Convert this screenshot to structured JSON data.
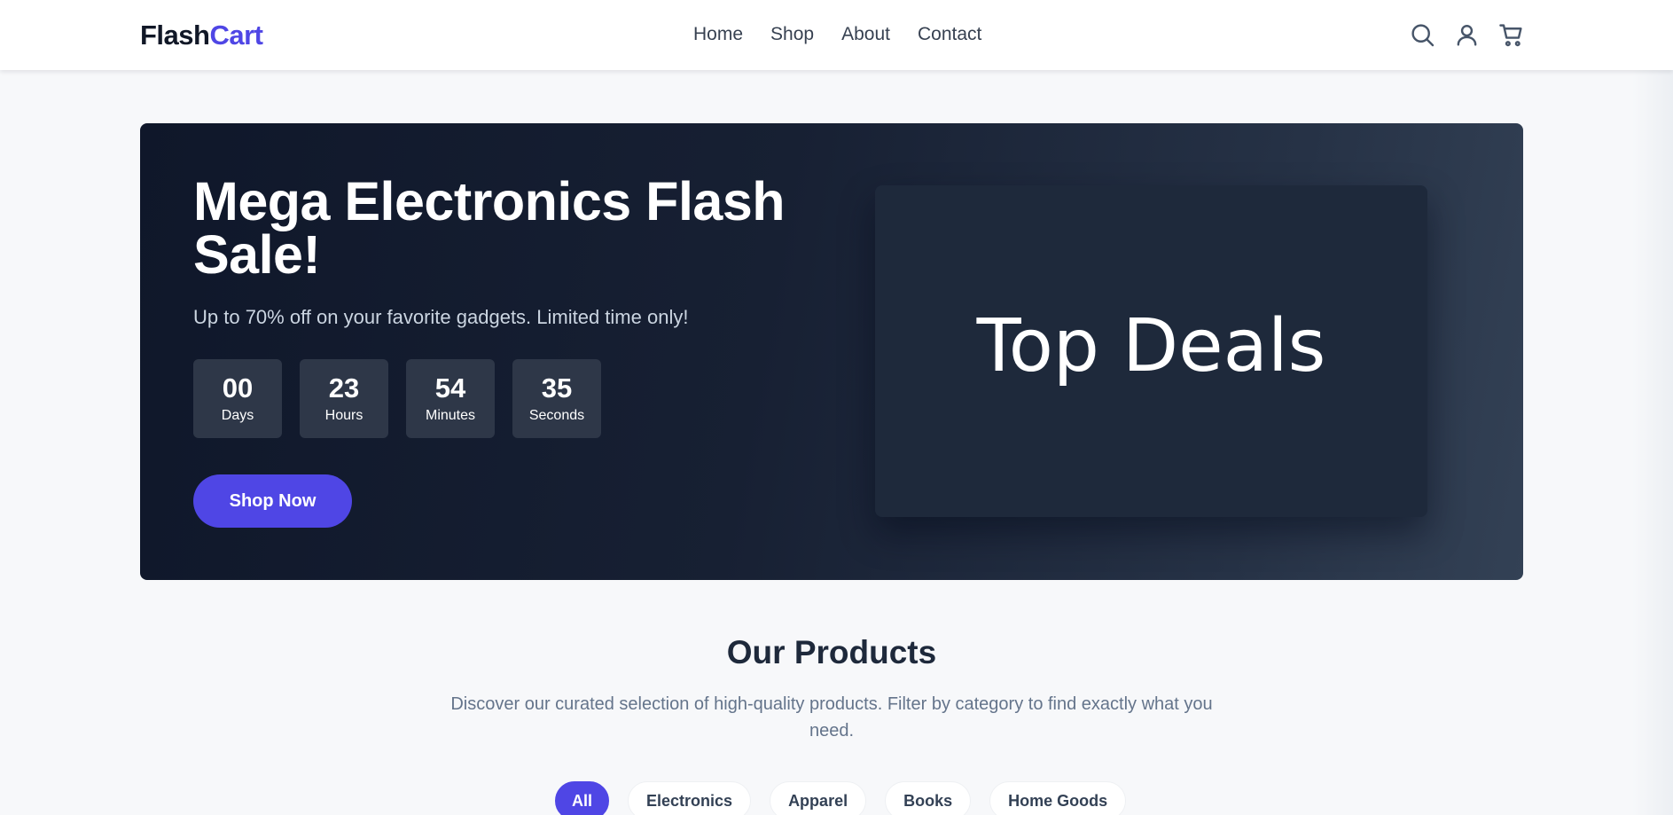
{
  "brand": {
    "part1": "Flash",
    "part2": "Cart",
    "accent_color": "#4f46e5"
  },
  "nav": {
    "items": [
      "Home",
      "Shop",
      "About",
      "Contact"
    ]
  },
  "header_icons": [
    "search-icon",
    "user-icon",
    "cart-icon"
  ],
  "hero": {
    "title": "Mega Electronics Flash Sale!",
    "subtitle": "Up to 70% off on your favorite gadgets. Limited time only!",
    "countdown": [
      {
        "value": "00",
        "label": "Days"
      },
      {
        "value": "23",
        "label": "Hours"
      },
      {
        "value": "54",
        "label": "Minutes"
      },
      {
        "value": "35",
        "label": "Seconds"
      }
    ],
    "cta_label": "Shop Now",
    "image_text": "Top Deals"
  },
  "products": {
    "title": "Our Products",
    "description": "Discover our curated selection of high-quality products. Filter by category to find exactly what you need.",
    "filters": [
      "All",
      "Electronics",
      "Apparel",
      "Books",
      "Home Goods"
    ],
    "active_filter": "All"
  }
}
